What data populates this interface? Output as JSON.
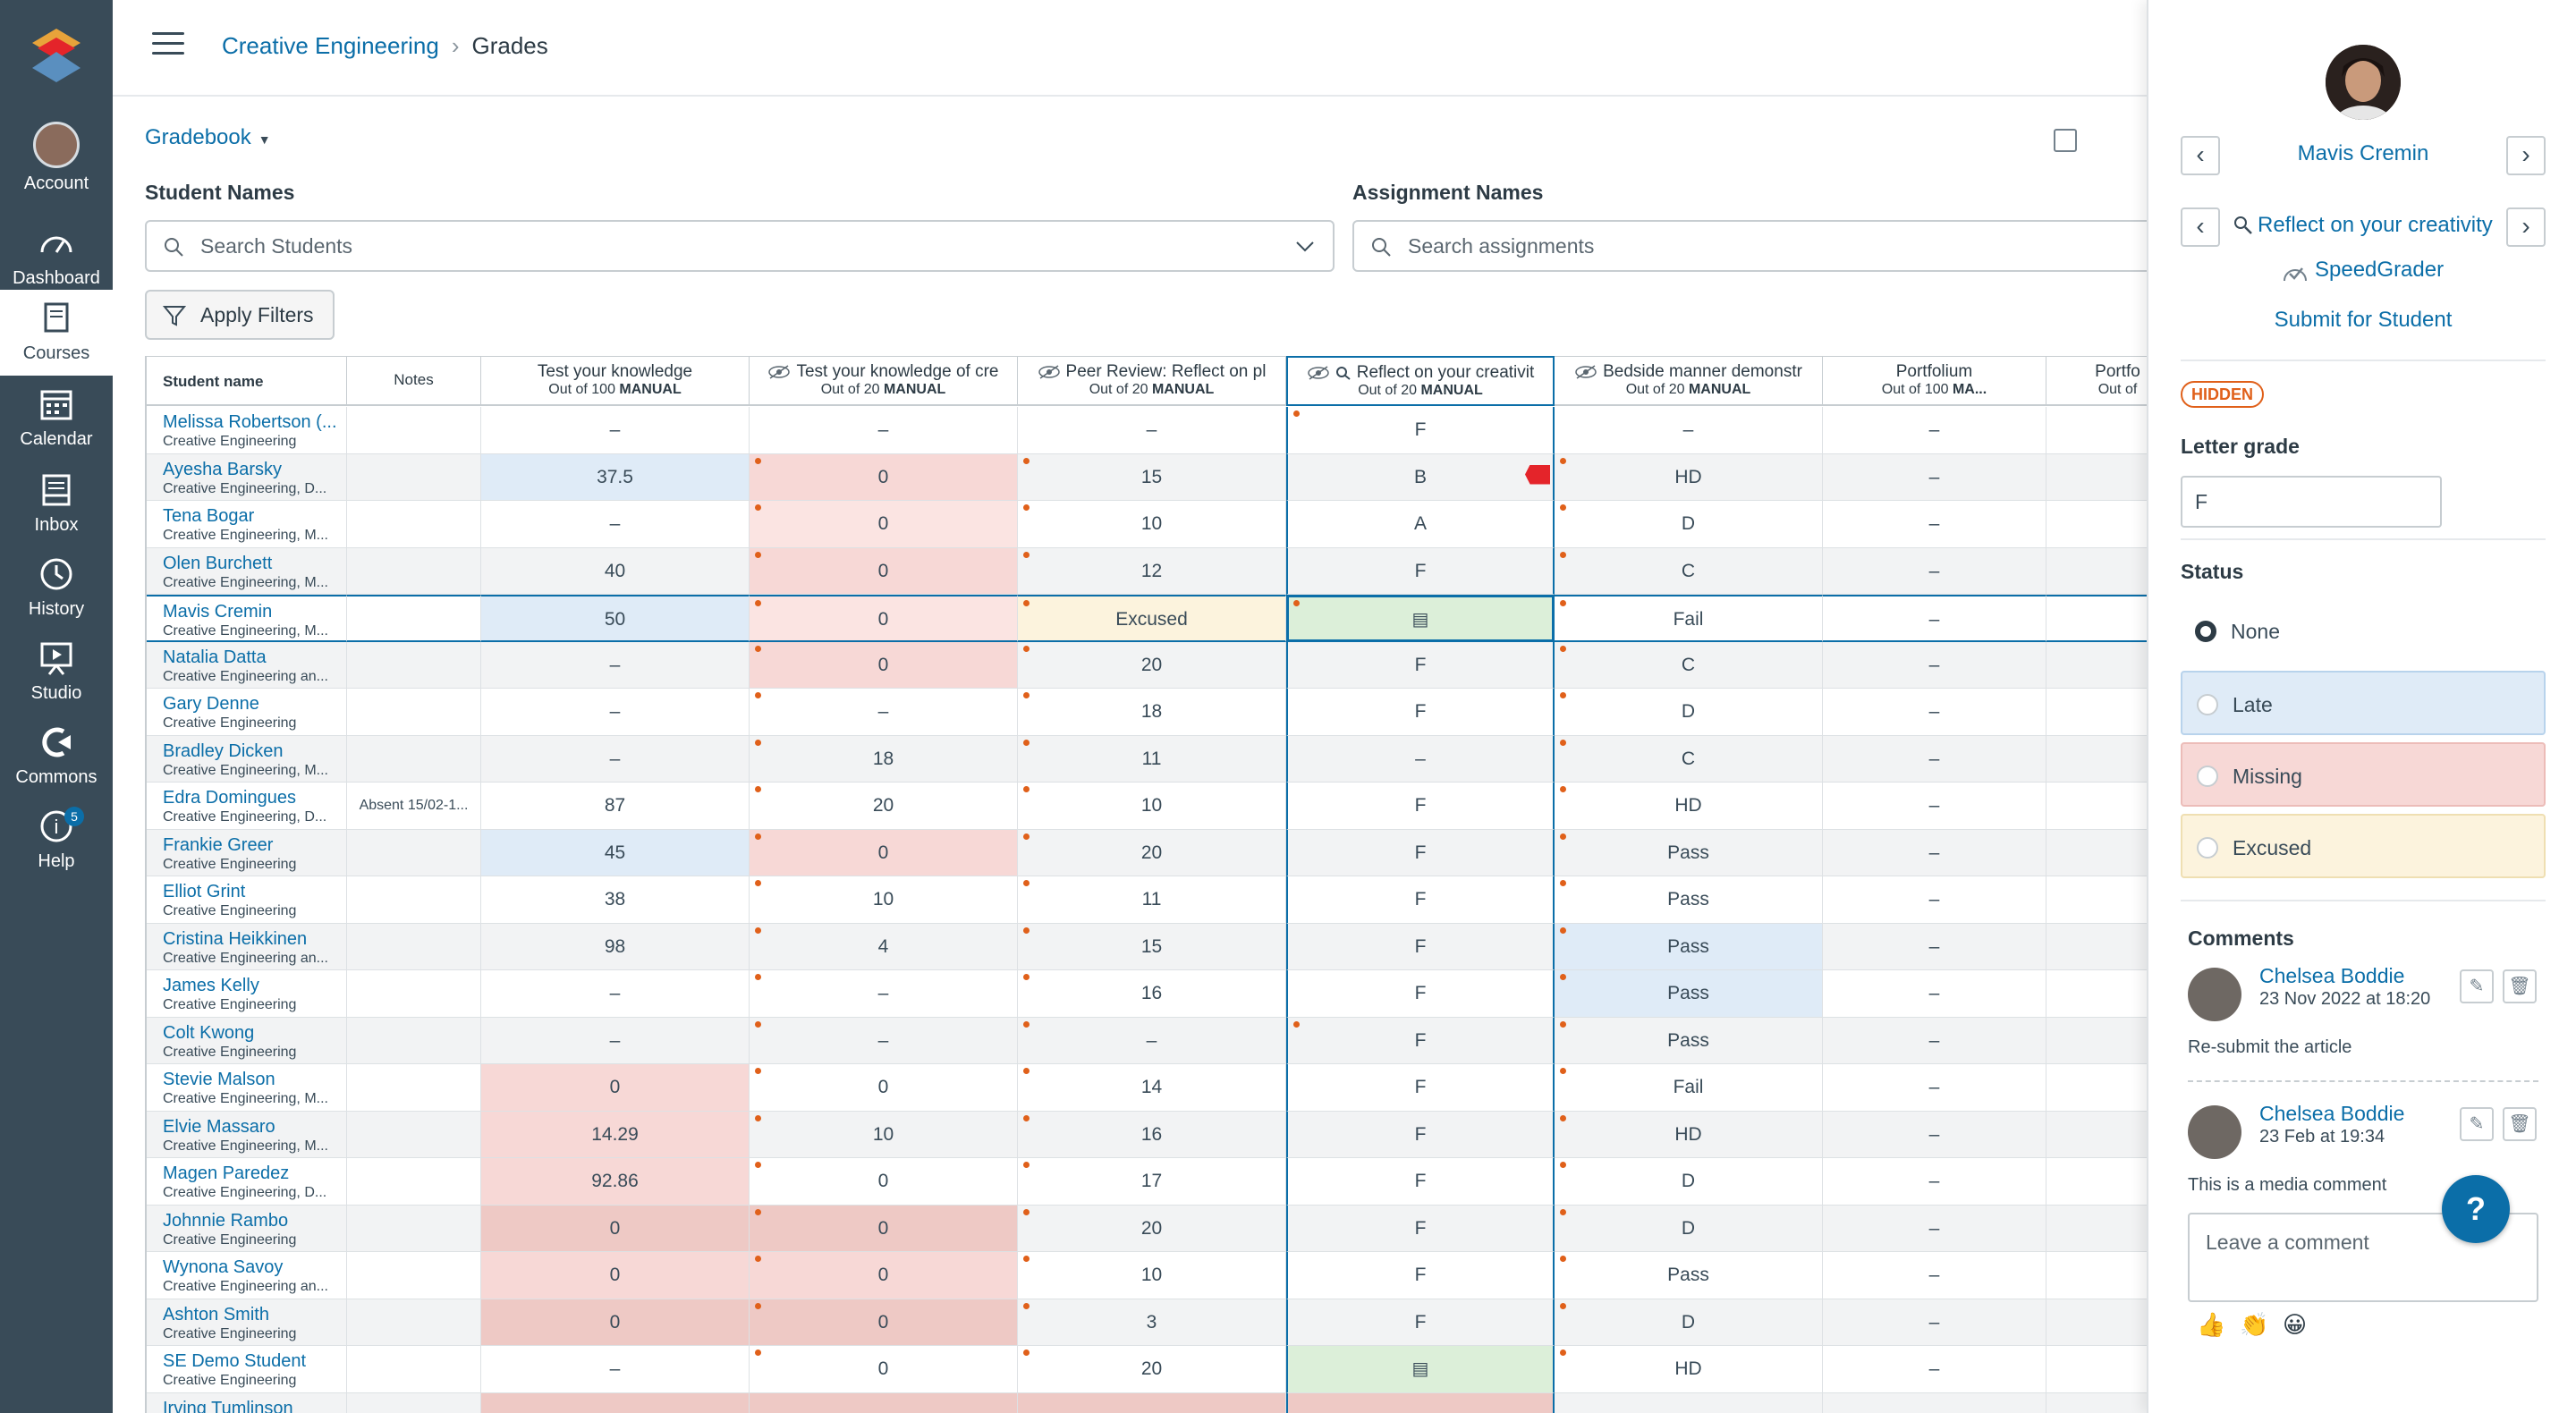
{
  "nav": {
    "items": [
      {
        "label": "Account",
        "icon": "account-avatar"
      },
      {
        "label": "Dashboard",
        "icon": "dashboard-icon"
      },
      {
        "label": "Courses",
        "icon": "courses-icon"
      },
      {
        "label": "Calendar",
        "icon": "calendar-icon"
      },
      {
        "label": "Inbox",
        "icon": "inbox-icon"
      },
      {
        "label": "History",
        "icon": "history-icon"
      },
      {
        "label": "Studio",
        "icon": "studio-icon"
      },
      {
        "label": "Commons",
        "icon": "commons-icon"
      },
      {
        "label": "Help",
        "icon": "help-icon",
        "badge": "5"
      }
    ]
  },
  "breadcrumb": {
    "course": "Creative Engineering",
    "page": "Grades"
  },
  "gradebook": {
    "menu_label": "Gradebook"
  },
  "filters": {
    "student_label": "Student Names",
    "student_placeholder": "Search Students",
    "assignment_label": "Assignment Names",
    "assignment_placeholder": "Search assignments",
    "apply_label": "Apply Filters"
  },
  "grid": {
    "columns": [
      {
        "title": "Student name",
        "sub": ""
      },
      {
        "title": "Notes",
        "sub": ""
      },
      {
        "title": "Test your knowledge",
        "sub": "Out of 100",
        "tag": "MANUAL"
      },
      {
        "title": "Test your knowledge of cre",
        "sub": "Out of 20",
        "tag": "MANUAL"
      },
      {
        "title": "Peer Review: Reflect on pl",
        "sub": "Out of 20",
        "tag": "MANUAL"
      },
      {
        "title": "Reflect on your creativit",
        "sub": "Out of 20",
        "tag": "MANUAL"
      },
      {
        "title": "Bedside manner demonstr",
        "sub": "Out of 20",
        "tag": "MANUAL"
      },
      {
        "title": "Portfolium",
        "sub": "Out of 100",
        "tag": "MA..."
      },
      {
        "title": "Portfo",
        "sub": "Out of",
        "tag": ""
      }
    ],
    "rows": [
      {
        "name": "Melissa Robertson (...",
        "section": "Creative Engineering",
        "notes": "",
        "c": [
          "–",
          "–",
          "–",
          "F",
          "–",
          "–"
        ]
      },
      {
        "name": "Ayesha Barsky",
        "section": "Creative Engineering, D...",
        "notes": "",
        "c": [
          "37.5",
          "0",
          "15",
          "B",
          "HD",
          "–"
        ]
      },
      {
        "name": "Tena Bogar",
        "section": "Creative Engineering, M...",
        "notes": "",
        "c": [
          "–",
          "0",
          "10",
          "A",
          "D",
          "–"
        ]
      },
      {
        "name": "Olen Burchett",
        "section": "Creative Engineering, M...",
        "notes": "",
        "c": [
          "40",
          "0",
          "12",
          "F",
          "C",
          "–"
        ]
      },
      {
        "name": "Mavis Cremin",
        "section": "Creative Engineering, M...",
        "notes": "",
        "c": [
          "50",
          "0",
          "Excused",
          "",
          "Fail",
          "–"
        ]
      },
      {
        "name": "Natalia Datta",
        "section": "Creative Engineering an...",
        "notes": "",
        "c": [
          "–",
          "0",
          "20",
          "F",
          "C",
          "–"
        ]
      },
      {
        "name": "Gary Denne",
        "section": "Creative Engineering",
        "notes": "",
        "c": [
          "–",
          "–",
          "18",
          "F",
          "D",
          "–"
        ]
      },
      {
        "name": "Bradley Dicken",
        "section": "Creative Engineering, M...",
        "notes": "",
        "c": [
          "–",
          "18",
          "11",
          "–",
          "C",
          "–"
        ]
      },
      {
        "name": "Edra Domingues",
        "section": "Creative Engineering, D...",
        "notes": "Absent 15/02-1...",
        "c": [
          "87",
          "20",
          "10",
          "F",
          "HD",
          "–"
        ]
      },
      {
        "name": "Frankie Greer",
        "section": "Creative Engineering",
        "notes": "",
        "c": [
          "45",
          "0",
          "20",
          "F",
          "Pass",
          "–"
        ]
      },
      {
        "name": "Elliot Grint",
        "section": "Creative Engineering",
        "notes": "",
        "c": [
          "38",
          "10",
          "11",
          "F",
          "Pass",
          "–"
        ]
      },
      {
        "name": "Cristina Heikkinen",
        "section": "Creative Engineering an...",
        "notes": "",
        "c": [
          "98",
          "4",
          "15",
          "F",
          "Pass",
          "–"
        ]
      },
      {
        "name": "James Kelly",
        "section": "Creative Engineering",
        "notes": "",
        "c": [
          "–",
          "–",
          "16",
          "F",
          "Pass",
          "–"
        ]
      },
      {
        "name": "Colt Kwong",
        "section": "Creative Engineering",
        "notes": "",
        "c": [
          "–",
          "–",
          "–",
          "F",
          "Pass",
          "–"
        ]
      },
      {
        "name": "Stevie Malson",
        "section": "Creative Engineering, M...",
        "notes": "",
        "c": [
          "0",
          "0",
          "14",
          "F",
          "Fail",
          "–"
        ]
      },
      {
        "name": "Elvie Massaro",
        "section": "Creative Engineering, M...",
        "notes": "",
        "c": [
          "14.29",
          "10",
          "16",
          "F",
          "HD",
          "–"
        ]
      },
      {
        "name": "Magen Paredez",
        "section": "Creative Engineering, D...",
        "notes": "",
        "c": [
          "92.86",
          "0",
          "17",
          "F",
          "D",
          "–"
        ]
      },
      {
        "name": "Johnnie Rambo",
        "section": "Creative Engineering",
        "notes": "",
        "c": [
          "0",
          "0",
          "20",
          "F",
          "D",
          "–"
        ]
      },
      {
        "name": "Wynona Savoy",
        "section": "Creative Engineering an...",
        "notes": "",
        "c": [
          "0",
          "0",
          "10",
          "F",
          "Pass",
          "–"
        ]
      },
      {
        "name": "Ashton Smith",
        "section": "Creative Engineering",
        "notes": "",
        "c": [
          "0",
          "0",
          "3",
          "F",
          "D",
          "–"
        ]
      },
      {
        "name": "SE Demo Student",
        "section": "Creative Engineering",
        "notes": "",
        "c": [
          "–",
          "0",
          "20",
          "",
          "HD",
          "–"
        ]
      },
      {
        "name": "Irving Tumlinson",
        "section": "",
        "notes": "",
        "c": [
          "",
          "",
          "",
          "",
          "",
          ""
        ]
      }
    ]
  },
  "tray": {
    "student_name": "Mavis Cremin",
    "assignment_name": "Reflect on your creativity",
    "speedgrader": "SpeedGrader",
    "submit_for_student": "Submit for Student",
    "hidden_pill": "HIDDEN",
    "letter_grade_label": "Letter grade",
    "letter_grade_value": "F",
    "status_label": "Status",
    "status_options": [
      "None",
      "Late",
      "Missing",
      "Excused"
    ],
    "comments_label": "Comments",
    "comments": [
      {
        "author": "Chelsea Boddie",
        "date": "23 Nov 2022 at 18:20",
        "text": "Re-submit the article"
      },
      {
        "author": "Chelsea Boddie",
        "date": "23 Feb at 19:34",
        "text": "This is a media comment"
      }
    ],
    "comment_placeholder": "Leave a comment"
  },
  "colors": {
    "nav_bg": "#394b58",
    "link": "#0b6ea8",
    "late": "#dfebf7",
    "missing": "#f7d8d6",
    "excused": "#fcf3dd",
    "dropped": "#dcefd9",
    "accent_orange": "#e0601a"
  }
}
